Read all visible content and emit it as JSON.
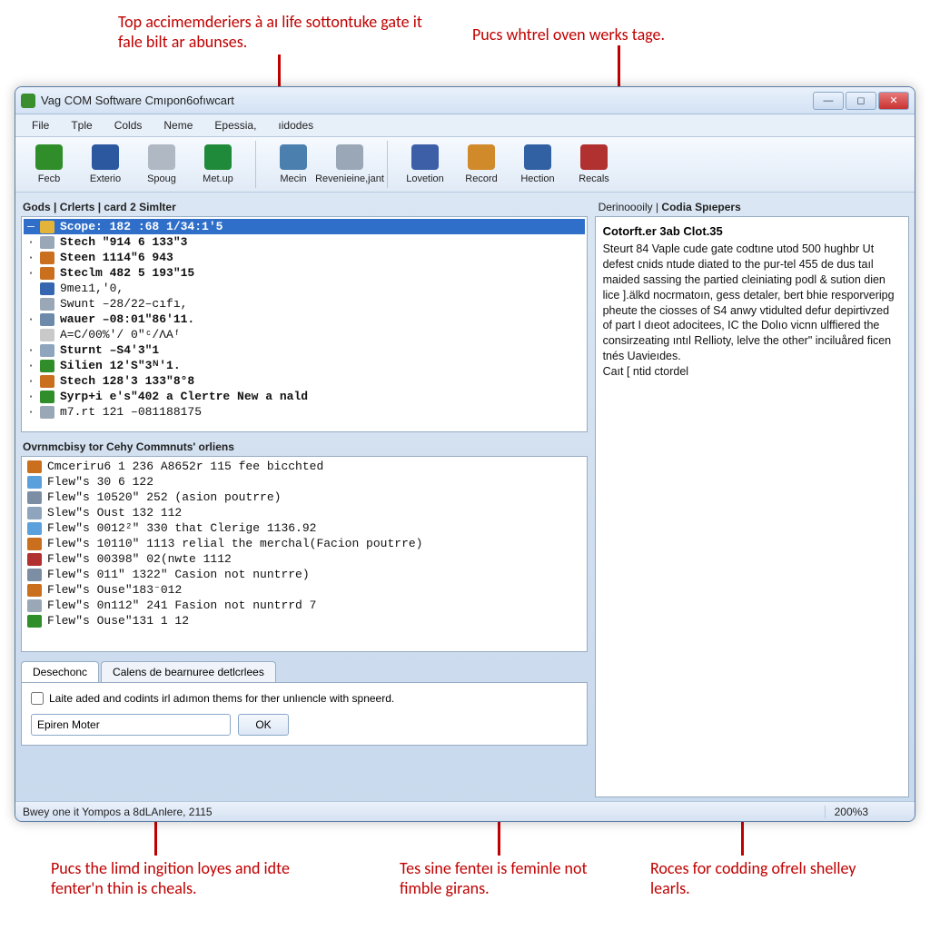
{
  "annotations": {
    "top_left": "Top accimemderiers à aı life sottontuke gate it fale bilt ar abunses.",
    "top_right": "Pucs whtrel oven werks tage.",
    "bottom_left": "Pucs the limd ingition loyes and idte fenter'n thin is cheals.",
    "bottom_mid": "Tes sine fenteı is feminle not fimble girans.",
    "bottom_right": "Roces for codding ofrelı shelley learls."
  },
  "window": {
    "title": "Vag COM Software Cmıpon6ofıwcart"
  },
  "menu": [
    "File",
    "Tple",
    "Colds",
    "Neme",
    "Epessia,",
    "ıidodes"
  ],
  "toolbar": {
    "g1": [
      {
        "label": "Fecb",
        "bg": "#2f8e2a"
      },
      {
        "label": "Exterio",
        "bg": "#2c58a0"
      },
      {
        "label": "Spoug",
        "bg": "#b0b8c4"
      },
      {
        "label": "Met.up",
        "bg": "#1f8b3a"
      }
    ],
    "g2": [
      {
        "label": "Mecin",
        "bg": "#4a7fae"
      },
      {
        "label": "Revenieine,jant",
        "bg": "#9aa7b6"
      }
    ],
    "g3": [
      {
        "label": "Lovetion",
        "bg": "#3c5fa8"
      },
      {
        "label": "Record",
        "bg": "#d18a2a"
      },
      {
        "label": "Hection",
        "bg": "#3261a3"
      },
      {
        "label": "Recals",
        "bg": "#b13030"
      }
    ]
  },
  "panel1": {
    "header": "Gods | Crlerts | card 2 Simlter",
    "rows": [
      {
        "icon": "#e4b43a",
        "bullet": "—",
        "text": "Scope: 182 :68  1/34:1'5",
        "bold": true,
        "selected": true
      },
      {
        "icon": "#9aa7b6",
        "bullet": "·",
        "text": "Stech  \"914 6 133\"3",
        "bold": true
      },
      {
        "icon": "#c96f1d",
        "bullet": "·",
        "text": "Steen  1114\"6 943",
        "bold": true
      },
      {
        "icon": "#c96f1d",
        "bullet": "·",
        "text": "Steclm 482 5 193\"15",
        "bold": true
      },
      {
        "icon": "#3666b0",
        "bullet": "",
        "text": "9meı1,'0,",
        "bold": false
      },
      {
        "icon": "#9aa7b6",
        "bullet": "",
        "text": "Swunt –28/22–cıfı,",
        "bold": false
      },
      {
        "icon": "#6e8aab",
        "bullet": "·",
        "text": "wauer –08:01\"86'11.",
        "bold": true
      },
      {
        "icon": "#c9c9c9",
        "bullet": "",
        "text": "A=C/00%'/ 0\"ᶜ/ΛAᶠ",
        "bold": false
      },
      {
        "icon": "#8fa5bd",
        "bullet": "·",
        "text": "Sturnt –S4'3\"1",
        "bold": true
      },
      {
        "icon": "#2f8e2a",
        "bullet": "·",
        "text": "Silien  12'S\"3ᴺ'1.",
        "bold": true
      },
      {
        "icon": "#c96f1d",
        "bullet": "·",
        "text": "Stech  128'3 133\"8°8",
        "bold": true
      },
      {
        "icon": "#2f8e2a",
        "bullet": "·",
        "text": "Syrp+i e's\"402 a Clertre New a nald",
        "bold": true
      },
      {
        "icon": "#9aa7b6",
        "bullet": "·",
        "text": "m7.rt 121  –081188175",
        "bold": false
      }
    ]
  },
  "panel2": {
    "header": "Ovrnmcbisy tor Cehy Commnuts' orliens",
    "rows": [
      {
        "icon": "#c96f1d",
        "text": "Cmceriru6 1 236 A8652r 115 fee bicchted"
      },
      {
        "icon": "#5aa0dc",
        "text": "Flew\"s 30 6 122"
      },
      {
        "icon": "#7c8ea4",
        "text": "Flew\"s 10520\" 252 (asion poutrre)"
      },
      {
        "icon": "#8fa5bd",
        "text": "Slew\"s Oust 132 112"
      },
      {
        "icon": "#5aa0dc",
        "text": "Flew\"s 0012²\" 330 that Clerige 1136.92"
      },
      {
        "icon": "#c96f1d",
        "text": "Flew\"s 10110\" 1113 relial the merchal(Facion poutrre)"
      },
      {
        "icon": "#b13030",
        "text": "Flew\"s 00398\" 02(nᴡte 1112"
      },
      {
        "icon": "#7c8ea4",
        "text": "Flew\"s 011\" 1322\" Casion not nuntrre)"
      },
      {
        "icon": "#c96f1d",
        "text": "Flew\"s Ouse\"183⁻012"
      },
      {
        "icon": "#9aa7b6",
        "text": "Flew\"s 0n112\" 241 Fasion not nuntrrd 7"
      },
      {
        "icon": "#2f8e2a",
        "text": "Flew\"s Ouse\"131 1 12"
      }
    ]
  },
  "tabs": {
    "t1": "Desechonc",
    "t2": "Calens de bearnuree detlcrlees",
    "check_label": "Laite aded and codints irl adımon thems for ther unlıencle with spneerd.",
    "input_value": "Epiren Moter",
    "ok": "OK"
  },
  "right": {
    "header_a": "Derinoooily | ",
    "header_b": "Codia Spıepers",
    "title": "Cotorft.er 3ab Clot.35",
    "body": "Steurt 84 Vaple cude gate codtıne utod 500 hughbr Ut defest cnids ntude diated to the pur-tel 455 de dus taıl maided sassing the partied cleiniating podl & sution dien lice ].älkd nocrmatoın, gess detaler, bert bhie resporveripg pheute the ciosses of S4 anwy vtidulted defur depirtivzed of part I dıeot adocitees, IC the Dolıo vicnn ulffiered the consirzeating ıntıl Rellioty, lelve the other\" inciluåred ficen tnés Uavieıdes.\nCaıt [ ntid ctordel"
  },
  "status": {
    "left": "Bwey one it Yompos a 8dLAnlere, 2115",
    "right": "200%3"
  }
}
